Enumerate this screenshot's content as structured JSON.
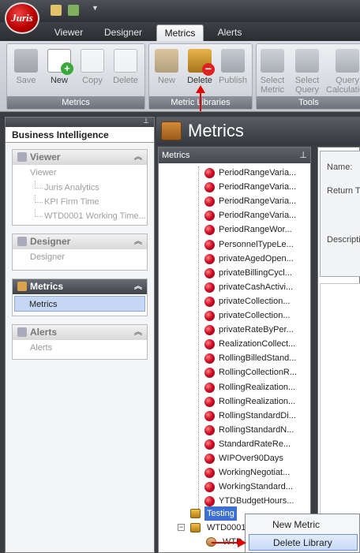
{
  "app": {
    "logo_text": "Juris"
  },
  "tabs": [
    {
      "label": "Viewer"
    },
    {
      "label": "Designer"
    },
    {
      "label": "Metrics"
    },
    {
      "label": "Alerts"
    }
  ],
  "ribbon": {
    "groups": [
      {
        "label": "Metrics",
        "buttons": [
          "Save",
          "New",
          "Copy",
          "Delete"
        ]
      },
      {
        "label": "Metric Libraries",
        "buttons": [
          "New",
          "Delete",
          "Publish"
        ]
      },
      {
        "label": "Tools",
        "buttons": [
          "Select\nMetric",
          "Select\nQuery",
          "Query\nCalculation"
        ]
      }
    ]
  },
  "left_panel": {
    "title": "Business Intelligence",
    "sections": [
      {
        "label": "Viewer",
        "items": [
          "Viewer"
        ],
        "subitems": [
          "Juris Analytics",
          "KPI Firm Time",
          "WTD0001 Working Time..."
        ]
      },
      {
        "label": "Designer",
        "items": [
          "Designer"
        ]
      },
      {
        "label": "Metrics",
        "items": [
          "Metrics"
        ]
      },
      {
        "label": "Alerts",
        "items": [
          "Alerts"
        ]
      }
    ]
  },
  "main": {
    "title": "Metrics",
    "tree_header": "Metrics",
    "tree_nodes": [
      "PeriodRangeVaria...",
      "PeriodRangeVaria...",
      "PeriodRangeVaria...",
      "PeriodRangeVaria...",
      "PeriodRangeWor...",
      "PersonnelTypeLe...",
      "privateAgedOpen...",
      "privateBillingCycl...",
      "privateCashActivi...",
      "privateCollection...",
      "privateCollection...",
      "privateRateByPer...",
      "RealizationCollect...",
      "RollingBilledStand...",
      "RollingCollectionR...",
      "RollingRealization...",
      "RollingRealization...",
      "RollingStandardDi...",
      "RollingStandardN...",
      "StandardRateRe...",
      "WIPOver90Days",
      "WorkingNegotiat...",
      "WorkingStandard...",
      "YTDBudgetHours..."
    ],
    "folders": [
      "Testing",
      "WTD0001",
      "WTD..."
    ],
    "detail_labels": [
      "Name:",
      "Return Ty",
      "Descriptio"
    ]
  },
  "context_menu": {
    "items": [
      "New Metric",
      "Delete Library"
    ]
  }
}
